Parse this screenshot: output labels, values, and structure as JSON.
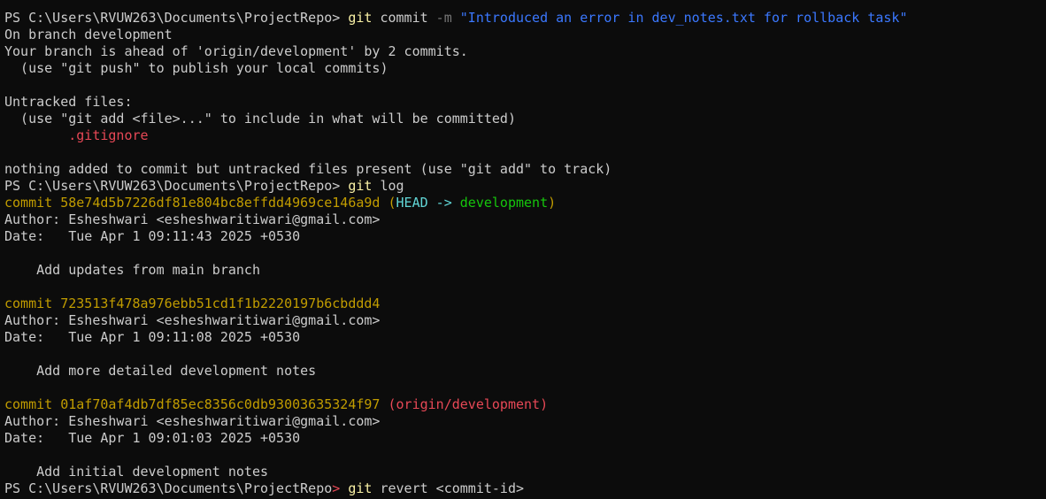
{
  "colors": {
    "background": "#0c0c0c",
    "foreground": "#cccccc",
    "command": "#f9f1a5",
    "flag": "#767676",
    "string": "#3b78ff",
    "untracked": "#e74856",
    "commit_hash": "#c19c00",
    "head": "#61d6d6",
    "branch": "#16c60c",
    "remote_branch": "#e74856"
  },
  "prompt": "PS C:\\Users\\RVUW263\\Documents\\ProjectRepo> ",
  "cmd1": {
    "program": "git",
    "subcommand": " commit ",
    "flag": "-m",
    "message": " \"Introduced an error in dev_notes.txt for rollback task\""
  },
  "status": {
    "branch_line": "On branch development",
    "ahead_line": "Your branch is ahead of 'origin/development' by 2 commits.",
    "push_hint": "  (use \"git push\" to publish your local commits)",
    "untracked_header": "Untracked files:",
    "add_hint": "  (use \"git add <file>...\" to include in what will be committed)",
    "untracked_file": "        .gitignore",
    "nothing_added": "nothing added to commit but untracked files present (use \"git add\" to track)"
  },
  "cmd2": {
    "program": "git",
    "args": " log"
  },
  "commits": [
    {
      "hash_line": "commit 58e74d5b7226df81e804bc8effdd4969ce146a9d",
      "ref_open": " (",
      "head": "HEAD -> ",
      "branch": "development",
      "ref_close": ")",
      "author": "Author: Esheshwari <esheshwaritiwari@gmail.com>",
      "date": "Date:   Tue Apr 1 09:11:43 2025 +0530",
      "message": "    Add updates from main branch"
    },
    {
      "hash_line": "commit 723513f478a976ebb51cd1f1b2220197b6cbddd4",
      "author": "Author: Esheshwari <esheshwaritiwari@gmail.com>",
      "date": "Date:   Tue Apr 1 09:11:08 2025 +0530",
      "message": "    Add more detailed development notes"
    },
    {
      "hash_line": "commit 01af70af4db7df85ec8356c0db93003635324f97",
      "remote_ref": " (origin/development)",
      "author": "Author: Esheshwari <esheshwaritiwari@gmail.com>",
      "date": "Date:   Tue Apr 1 09:01:03 2025 +0530",
      "message": "    Add initial development notes"
    }
  ],
  "prompt_last": {
    "path": "PS C:\\Users\\RVUW263\\Documents\\ProjectRepo",
    "caret": ">"
  },
  "cmd3": {
    "program": "git",
    "args": " revert <commit-id>"
  }
}
